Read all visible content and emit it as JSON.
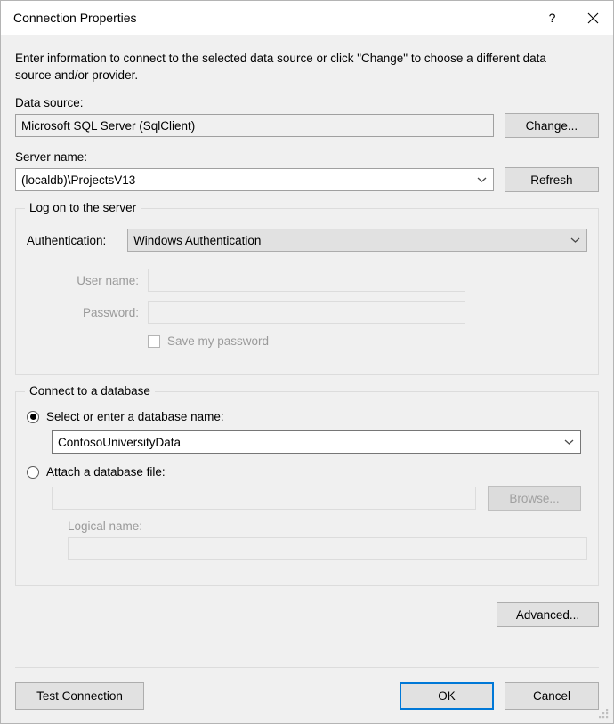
{
  "window": {
    "title": "Connection Properties",
    "help_icon": "question-mark-icon",
    "close_icon": "close-icon"
  },
  "intro": "Enter information to connect to the selected data source or click \"Change\" to choose a different data source and/or provider.",
  "data_source": {
    "label": "Data source:",
    "value": "Microsoft SQL Server (SqlClient)",
    "change_button": "Change..."
  },
  "server": {
    "label": "Server name:",
    "value": "(localdb)\\ProjectsV13",
    "refresh_button": "Refresh"
  },
  "logon_group": {
    "title": "Log on to the server",
    "authentication_label": "Authentication:",
    "authentication_value": "Windows Authentication",
    "username_label": "User name:",
    "username_value": "",
    "password_label": "Password:",
    "password_value": "",
    "save_password_label": "Save my password",
    "save_password_checked": false
  },
  "database_group": {
    "title": "Connect to a database",
    "select_radio_label": "Select or enter a database name:",
    "select_radio_checked": true,
    "database_value": "ContosoUniversityData",
    "attach_radio_label": "Attach a database file:",
    "attach_radio_checked": false,
    "attach_file_value": "",
    "browse_button": "Browse...",
    "logical_name_label": "Logical name:",
    "logical_name_value": ""
  },
  "footer": {
    "advanced_button": "Advanced...",
    "test_connection_button": "Test Connection",
    "ok_button": "OK",
    "cancel_button": "Cancel"
  },
  "colors": {
    "focus_blue": "#0078d7",
    "dialog_background": "#f0f0f0",
    "titlebar_background": "#ffffff"
  }
}
